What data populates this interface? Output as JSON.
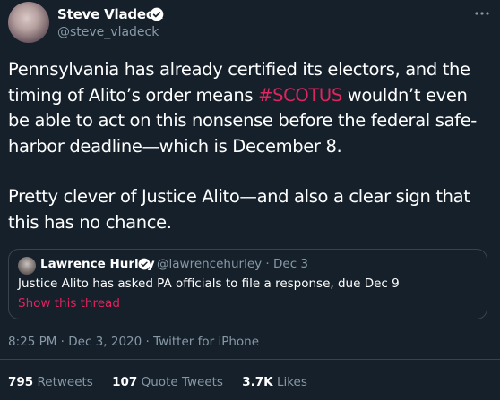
{
  "author": {
    "name": "Steve Vladeck",
    "handle": "@steve_vladeck"
  },
  "tweet": {
    "p1_before": "Pennsylvania has already certified its electors, and the timing of Alito’s order means ",
    "p1_hashtag": "#SCOTUS",
    "p1_after": " wouldn’t even be able to act on this nonsense before the federal safe-harbor deadline—which is December 8.",
    "p2": "Pretty clever of Justice Alito—and also a clear sign that this has no chance."
  },
  "quoted": {
    "name": "Lawrence Hurley",
    "handle_date": "@lawrencehurley · Dec 3",
    "text": "Justice Alito has asked PA officials to file a response, due Dec 9",
    "link": "Show this thread"
  },
  "meta": "8:25 PM · Dec 3, 2020 · Twitter for iPhone",
  "stats": {
    "retweets_count": "795",
    "retweets_label": "Retweets",
    "quotes_count": "107",
    "quotes_label": "Quote Tweets",
    "likes_count": "3.7K",
    "likes_label": "Likes"
  },
  "colors": {
    "background": "#15202b",
    "accent": "#e0245e",
    "secondary": "#8899a6",
    "verified": "#1da1f2"
  },
  "icons": [
    "verified-badge-icon",
    "more-options-icon"
  ]
}
